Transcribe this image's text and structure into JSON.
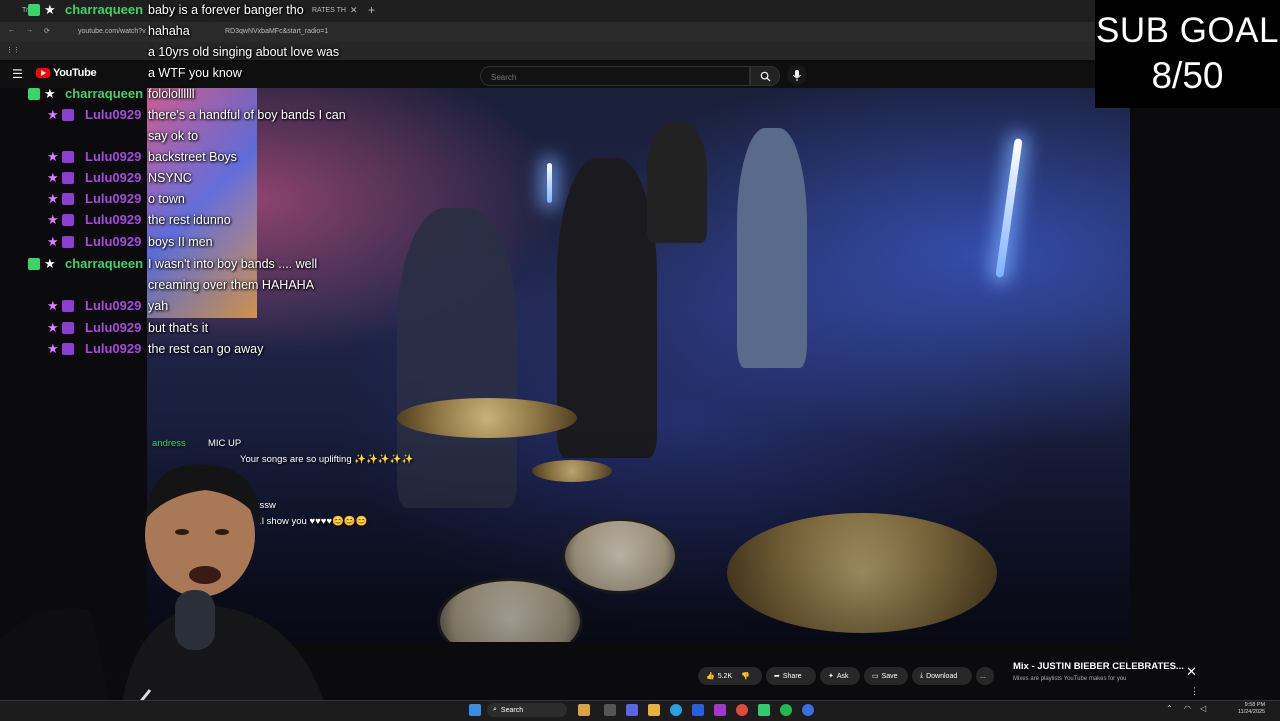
{
  "browser": {
    "tab_title": "Tr",
    "tab_title_2": "RATES TH",
    "new_tab": "+",
    "url": "youtube.com/watch?v",
    "url_tail": "RD3qwNVxbaMFc&start_radio=1"
  },
  "youtube": {
    "logo_text": "YouTube",
    "search_placeholder": "Search",
    "actions": {
      "likes": "5.2K",
      "share": "Share",
      "ask": "Ask",
      "save": "Save",
      "download": "Download",
      "more": "..."
    },
    "mix": {
      "title": "Mix - JUSTIN BIEBER CELEBRATES...",
      "subtitle": "Mixes are playlists YouTube makes for you",
      "close": "✕"
    }
  },
  "sub_goal": {
    "label": "SUB GOAL",
    "count": "8/50"
  },
  "chat": [
    {
      "user": "charraqueen",
      "badge": "green",
      "message": "baby is a forever banger tho"
    },
    {
      "user": "",
      "badge": "",
      "message": "hahaha"
    },
    {
      "user": "",
      "badge": "",
      "message": "a 10yrs old singing about love was"
    },
    {
      "user": "",
      "badge": "",
      "message": "a WTF you know"
    },
    {
      "user": "charraqueen",
      "badge": "green",
      "message": "fololollllll"
    },
    {
      "user": "Lulu0929",
      "badge": "purple",
      "message": "there's a handful of boy bands I can"
    },
    {
      "user": "",
      "badge": "",
      "message": "say ok to"
    },
    {
      "user": "Lulu0929",
      "badge": "purple",
      "message": "backstreet Boys"
    },
    {
      "user": "Lulu0929",
      "badge": "purple",
      "message": "NSYNC"
    },
    {
      "user": "Lulu0929",
      "badge": "purple",
      "message": "o town"
    },
    {
      "user": "Lulu0929",
      "badge": "purple",
      "message": "the rest idunno"
    },
    {
      "user": "Lulu0929",
      "badge": "purple",
      "message": "boys II men"
    },
    {
      "user": "charraqueen",
      "badge": "green",
      "message": "I wasn't into boy bands .... well"
    },
    {
      "user": "",
      "badge": "",
      "message": "creaming over them HAHAHA"
    },
    {
      "user": "Lulu0929",
      "badge": "purple",
      "message": "yah"
    },
    {
      "user": "Lulu0929",
      "badge": "purple",
      "message": "but that's it"
    },
    {
      "user": "Lulu0929",
      "badge": "purple",
      "message": "the rest can go away"
    }
  ],
  "overlay_chat": [
    {
      "user": "andress",
      "message": "MIC UP"
    },
    {
      "user": "",
      "message": "Your songs are so uplifting ✨✨✨✨✨"
    },
    {
      "user": "",
      "message": "ssssw"
    },
    {
      "user": "",
      "message": "'ll show you ♥♥♥♥😊😊😊"
    }
  ],
  "taskbar": {
    "search": "Search",
    "time": "9:58 PM",
    "date": "11/24/2025"
  },
  "colors": {
    "accent_red": "#ff0000",
    "charra_green": "#3bd36a",
    "lulu_purple": "#a24bdc"
  }
}
